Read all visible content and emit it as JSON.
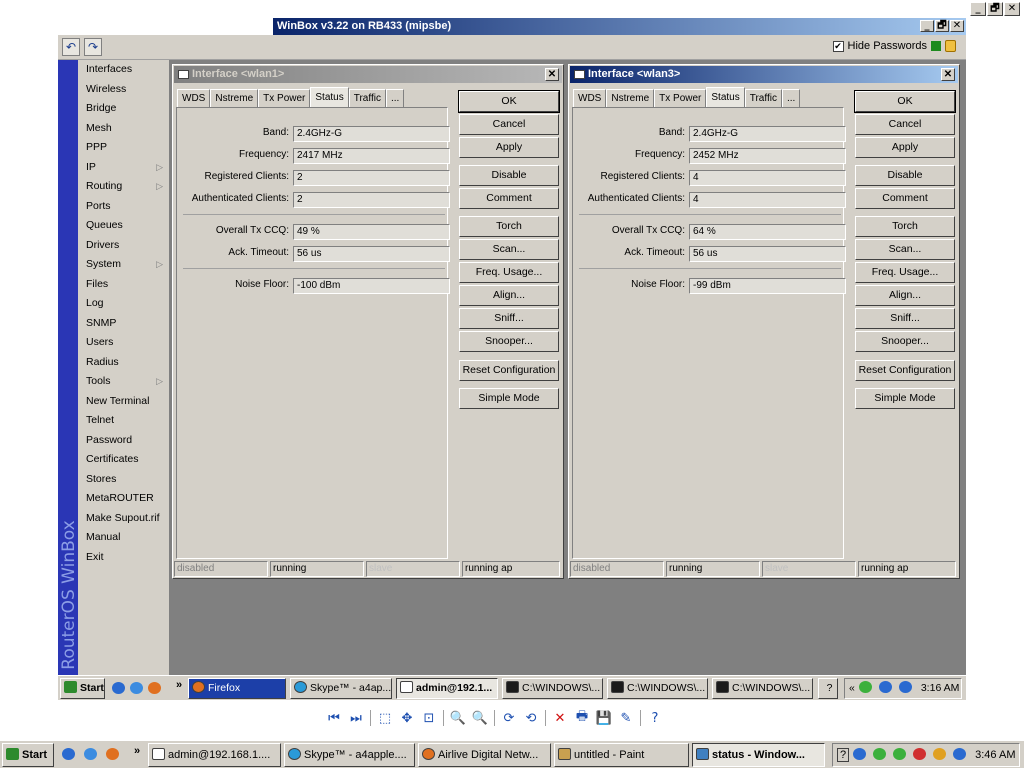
{
  "outer_window": {
    "controls": [
      "_",
      "🗗",
      "✕"
    ]
  },
  "winbox": {
    "title": "WinBox v3.22 on RB433 (mipsbe)",
    "toolbar": {
      "undo_glyph": "↶",
      "redo_glyph": "↷",
      "hide_passwords_label": "Hide Passwords",
      "hide_passwords_checked": true
    },
    "rail_text": "RouterOS WinBox",
    "menu": [
      {
        "label": "Interfaces",
        "submenu": false
      },
      {
        "label": "Wireless",
        "submenu": false
      },
      {
        "label": "Bridge",
        "submenu": false
      },
      {
        "label": "Mesh",
        "submenu": false
      },
      {
        "label": "PPP",
        "submenu": false
      },
      {
        "label": "IP",
        "submenu": true
      },
      {
        "label": "Routing",
        "submenu": true
      },
      {
        "label": "Ports",
        "submenu": false
      },
      {
        "label": "Queues",
        "submenu": false
      },
      {
        "label": "Drivers",
        "submenu": false
      },
      {
        "label": "System",
        "submenu": true
      },
      {
        "label": "Files",
        "submenu": false
      },
      {
        "label": "Log",
        "submenu": false
      },
      {
        "label": "SNMP",
        "submenu": false
      },
      {
        "label": "Users",
        "submenu": false
      },
      {
        "label": "Radius",
        "submenu": false
      },
      {
        "label": "Tools",
        "submenu": true
      },
      {
        "label": "New Terminal",
        "submenu": false
      },
      {
        "label": "Telnet",
        "submenu": false
      },
      {
        "label": "Password",
        "submenu": false
      },
      {
        "label": "Certificates",
        "submenu": false
      },
      {
        "label": "Stores",
        "submenu": false
      },
      {
        "label": "MetaROUTER",
        "submenu": false
      },
      {
        "label": "Make Supout.rif",
        "submenu": false
      },
      {
        "label": "Manual",
        "submenu": false
      },
      {
        "label": "Exit",
        "submenu": false
      }
    ],
    "dialogs": [
      {
        "title": "Interface <wlan1>",
        "active": false,
        "tabs": [
          "WDS",
          "Nstreme",
          "Tx Power",
          "Status",
          "Traffic",
          "..."
        ],
        "selected_tab": 3,
        "fields": {
          "band_label": "Band:",
          "band": "2.4GHz-G",
          "frequency_label": "Frequency:",
          "frequency": "2417 MHz",
          "registered_label": "Registered Clients:",
          "registered": "2",
          "authenticated_label": "Authenticated Clients:",
          "authenticated": "2",
          "ccq_label": "Overall Tx CCQ:",
          "ccq": "49 %",
          "ack_label": "Ack. Timeout:",
          "ack": "56 us",
          "noise_label": "Noise Floor:",
          "noise": "-100 dBm"
        },
        "buttons": [
          "OK",
          "Cancel",
          "Apply",
          "Disable",
          "Comment",
          "Torch",
          "Scan...",
          "Freq. Usage...",
          "Align...",
          "Sniff...",
          "Snooper...",
          "Reset Configuration",
          "Simple Mode"
        ],
        "status": [
          "disabled",
          "running",
          "slave",
          "running ap"
        ]
      },
      {
        "title": "Interface <wlan3>",
        "active": true,
        "tabs": [
          "WDS",
          "Nstreme",
          "Tx Power",
          "Status",
          "Traffic",
          "..."
        ],
        "selected_tab": 3,
        "fields": {
          "band_label": "Band:",
          "band": "2.4GHz-G",
          "frequency_label": "Frequency:",
          "frequency": "2452 MHz",
          "registered_label": "Registered Clients:",
          "registered": "4",
          "authenticated_label": "Authenticated Clients:",
          "authenticated": "4",
          "ccq_label": "Overall Tx CCQ:",
          "ccq": "64 %",
          "ack_label": "Ack. Timeout:",
          "ack": "56 us",
          "noise_label": "Noise Floor:",
          "noise": "-99 dBm"
        },
        "buttons": [
          "OK",
          "Cancel",
          "Apply",
          "Disable",
          "Comment",
          "Torch",
          "Scan...",
          "Freq. Usage...",
          "Align...",
          "Sniff...",
          "Snooper...",
          "Reset Configuration",
          "Simple Mode"
        ],
        "status": [
          "disabled",
          "running",
          "slave",
          "running ap"
        ]
      }
    ]
  },
  "inner_taskbar": {
    "start": "Start",
    "chevron": "»",
    "items": [
      {
        "label": "Firefox",
        "pressed": false
      },
      {
        "label": "Skype™ - a4ap...",
        "pressed": false
      },
      {
        "label": "admin@192.1...",
        "pressed": true
      },
      {
        "label": "C:\\WINDOWS\\...",
        "pressed": false
      },
      {
        "label": "C:\\WINDOWS\\...",
        "pressed": false
      },
      {
        "label": "C:\\WINDOWS\\...",
        "pressed": false
      }
    ],
    "help": "?",
    "tray_chevron": "«",
    "clock": "3:16 AM"
  },
  "viewer_toolbar": {
    "icons": [
      "prev-icon",
      "next-icon",
      "fit-icon",
      "actual-size-icon",
      "slideshow-icon",
      "zoom-in-icon",
      "zoom-out-icon",
      "rotate-cw-icon",
      "rotate-ccw-icon",
      "delete-icon",
      "print-icon",
      "save-icon",
      "edit-icon",
      "help-icon"
    ],
    "glyphs": [
      "⏮",
      "⏭",
      "⬚",
      "✥",
      "⊡",
      "🔍",
      "🔍",
      "⟳",
      "⟲",
      "✕",
      "🖶",
      "💾",
      "✎",
      "?"
    ]
  },
  "outer_taskbar": {
    "start": "Start",
    "chevron": "»",
    "items": [
      {
        "label": "admin@192.168.1....",
        "pressed": false
      },
      {
        "label": "Skype™ - a4apple....",
        "pressed": false
      },
      {
        "label": "Airlive Digital Netw...",
        "pressed": false
      },
      {
        "label": "untitled - Paint",
        "pressed": false
      },
      {
        "label": "status - Window...",
        "pressed": true
      }
    ],
    "help": "?",
    "clock": "3:46 AM"
  },
  "colors": {
    "title_active": "#0a246a",
    "rail": "#2a36b5",
    "desktop_grey": "#808080",
    "window_face": "#d4d0c8"
  }
}
